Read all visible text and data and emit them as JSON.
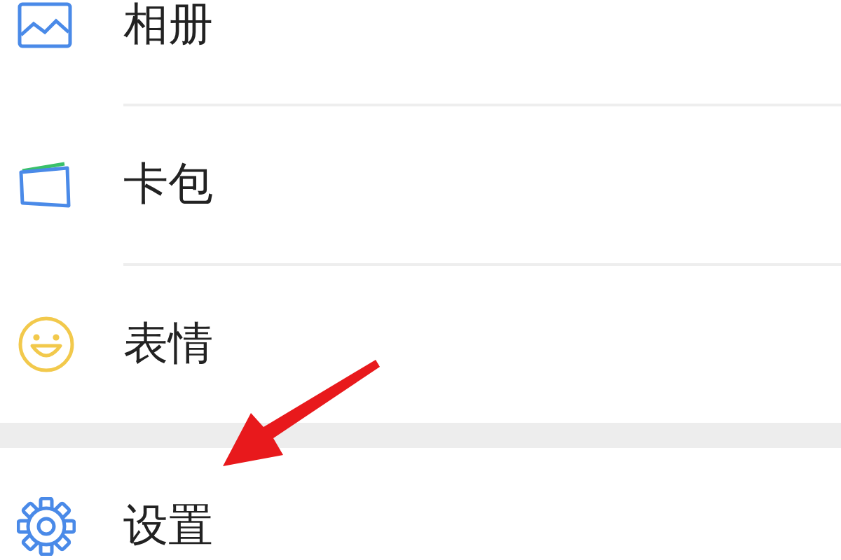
{
  "menu_groups": [
    {
      "items": [
        {
          "kind": "album",
          "label": "相册"
        },
        {
          "kind": "cards",
          "label": "卡包"
        },
        {
          "kind": "emoji",
          "label": "表情"
        }
      ]
    },
    {
      "items": [
        {
          "kind": "settings",
          "label": "设置"
        }
      ]
    }
  ],
  "annotation": {
    "kind": "arrow"
  }
}
